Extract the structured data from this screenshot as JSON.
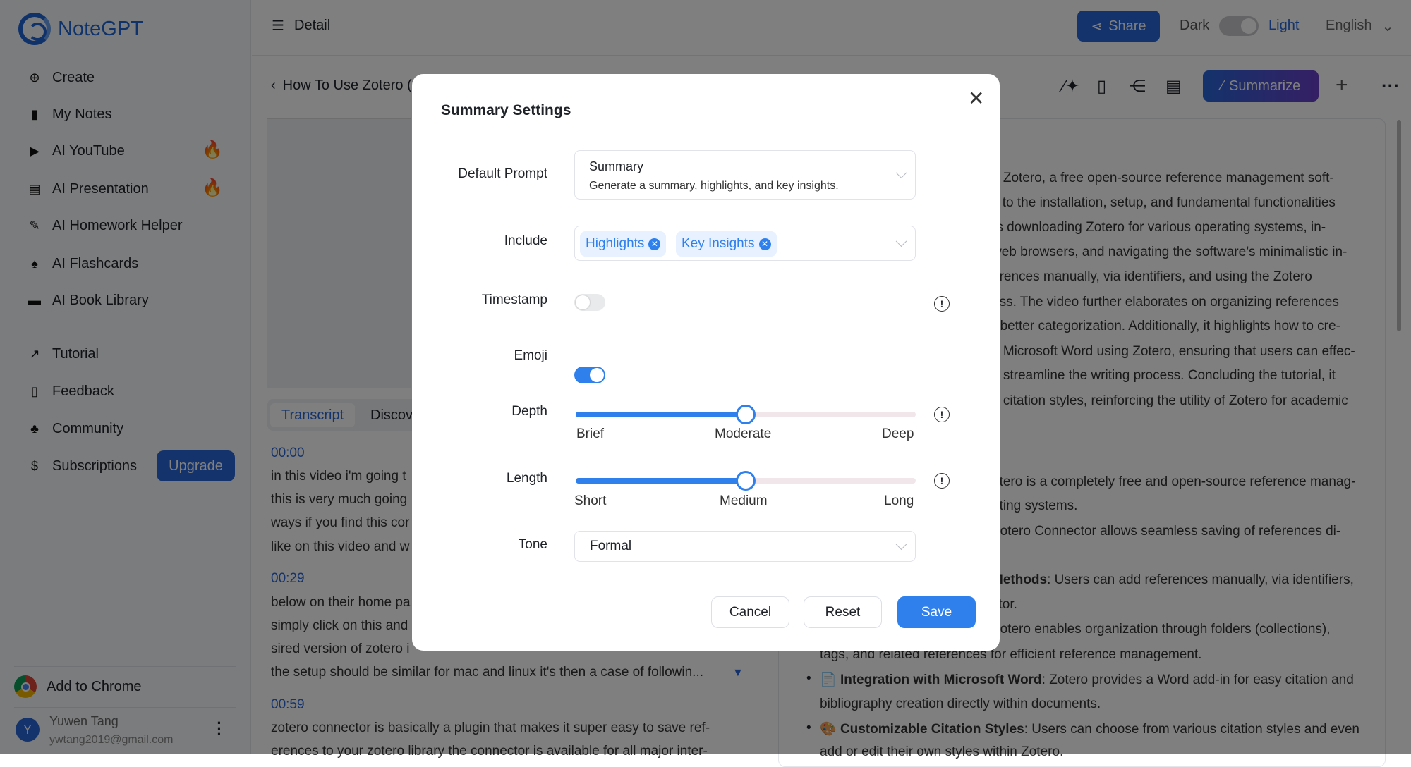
{
  "app": {
    "name": "NoteGPT"
  },
  "sidebar": {
    "items": [
      {
        "label": "Create",
        "icon": "plus-circle-icon"
      },
      {
        "label": "My Notes",
        "icon": "notebook-icon"
      },
      {
        "label": "AI YouTube",
        "icon": "youtube-icon",
        "hot": true
      },
      {
        "label": "AI Presentation",
        "icon": "presentation-icon",
        "hot": true
      },
      {
        "label": "AI Homework Helper",
        "icon": "homework-icon"
      },
      {
        "label": "AI Flashcards",
        "icon": "flashcards-icon"
      },
      {
        "label": "AI Book Library",
        "icon": "book-icon"
      }
    ],
    "secondary": [
      {
        "label": "Tutorial",
        "icon": "external-link-icon"
      },
      {
        "label": "Feedback",
        "icon": "document-icon"
      },
      {
        "label": "Community",
        "icon": "community-icon"
      },
      {
        "label": "Subscriptions",
        "icon": "dollar-icon"
      }
    ],
    "upgrade_label": "Upgrade",
    "add_to_chrome": "Add to Chrome",
    "user": {
      "initial": "Y",
      "name": "Yuwen Tang",
      "email": "ywtang2019@gmail.com"
    }
  },
  "header": {
    "title": "Detail",
    "share": "Share",
    "dark": "Dark",
    "light": "Light",
    "language": "English"
  },
  "left": {
    "video_title": "How To Use Zotero (",
    "tabs": [
      "Transcript",
      "Discov"
    ],
    "transcript": [
      {
        "time": "00:00",
        "lines": [
          "in this video i'm going t",
          "this is very much going",
          "ways if you find this cor",
          "like on this video and w"
        ]
      },
      {
        "time": "00:29",
        "lines": [
          "below on their home pa",
          "simply click on this and",
          "sired version of zotero i",
          "the setup should be similar for mac and linux it's then a case of followin..."
        ]
      },
      {
        "time": "00:59",
        "lines": [
          "zotero connector is basically a plugin that makes it super easy to save ref-",
          "erences to your zotero library the connector is available for all major inter-"
        ]
      }
    ]
  },
  "right": {
    "summarize": "Summarize",
    "paragraph": [
      "o Zotero, a free open-source reference management soft-",
      "s to the installation, setup, and fundamental functionalities",
      "rs downloading Zotero for various operating systems, in-",
      "web browsers, and navigating the software’s minimalistic in-",
      "erences manually, via identifiers, and using the Zotero",
      "ess. The video further elaborates on organizing references",
      "r better categorization. Additionally, it highlights how to cre-",
      "n Microsoft Word using Zotero, ensuring that users can effec-",
      "d streamline the writing process. Concluding the tutorial, it",
      "g citation styles, reinforcing the utility of Zotero for academic"
    ],
    "partial": [
      "otero is a completely free and open-source reference manag-",
      "ating systems.",
      "Zotero Connector allows seamless saving of references di-"
    ],
    "methods_bold": "Methods",
    "methods_rest": ": Users can add references manually, via identifiers,",
    "tor": "ctor.",
    "org": "Zotero enables organization through folders (collections),",
    "tags_line": "tags, and related references for efficient reference management.",
    "bullets": [
      {
        "bold": "Integration with Microsoft Word",
        "rest": ": Zotero provides a Word add-in for easy citation and",
        "cont": "bibliography creation directly within documents.",
        "emoji": "📄"
      },
      {
        "bold": "Customizable Citation Styles",
        "rest": ": Users can choose from various citation styles and even",
        "cont": "add or edit their own styles within Zotero.",
        "emoji": "🎨"
      }
    ]
  },
  "modal": {
    "title": "Summary Settings",
    "default_prompt": {
      "label": "Default Prompt",
      "value": "Summary",
      "description": "Generate a summary, highlights, and key insights."
    },
    "include": {
      "label": "Include",
      "tags": [
        "Highlights",
        "Key Insights"
      ]
    },
    "timestamp": {
      "label": "Timestamp",
      "on": false
    },
    "emoji": {
      "label": "Emoji",
      "on": true
    },
    "depth": {
      "label": "Depth",
      "options": [
        "Brief",
        "Moderate",
        "Deep"
      ],
      "value": "Moderate",
      "level": 0.5
    },
    "length": {
      "label": "Length",
      "options": [
        "Short",
        "Medium",
        "Long"
      ],
      "value": "Medium",
      "level": 0.5
    },
    "tone": {
      "label": "Tone",
      "value": "Formal"
    },
    "cancel": "Cancel",
    "reset": "Reset",
    "save": "Save"
  },
  "colors": {
    "primary": "#2866d8",
    "accent": "#2f80ed",
    "hot": "#d9303b"
  }
}
